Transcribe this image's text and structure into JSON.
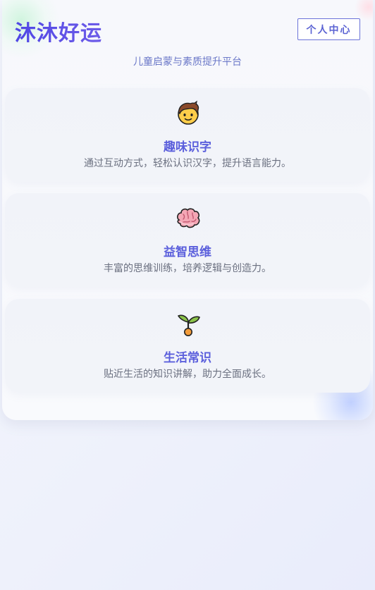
{
  "header": {
    "title": "沐沐好运",
    "profile_label": "个人中心",
    "subtitle": "儿童启蒙与素质提升平台"
  },
  "features": [
    {
      "icon": "child-face-icon",
      "title": "趣味识字",
      "desc": "通过互动方式，轻松认识汉字，提升语言能力。"
    },
    {
      "icon": "brain-icon",
      "title": "益智思维",
      "desc": "丰富的思维训练，培养逻辑与创造力。"
    },
    {
      "icon": "seedling-icon",
      "title": "生活常识",
      "desc": "贴近生活的知识讲解，助力全面成长。"
    }
  ],
  "colors": {
    "accent": "#4f46e5",
    "title_purple": "#5b5fdc",
    "subtitle": "#6b78c8",
    "desc_gray": "#6b7080"
  }
}
